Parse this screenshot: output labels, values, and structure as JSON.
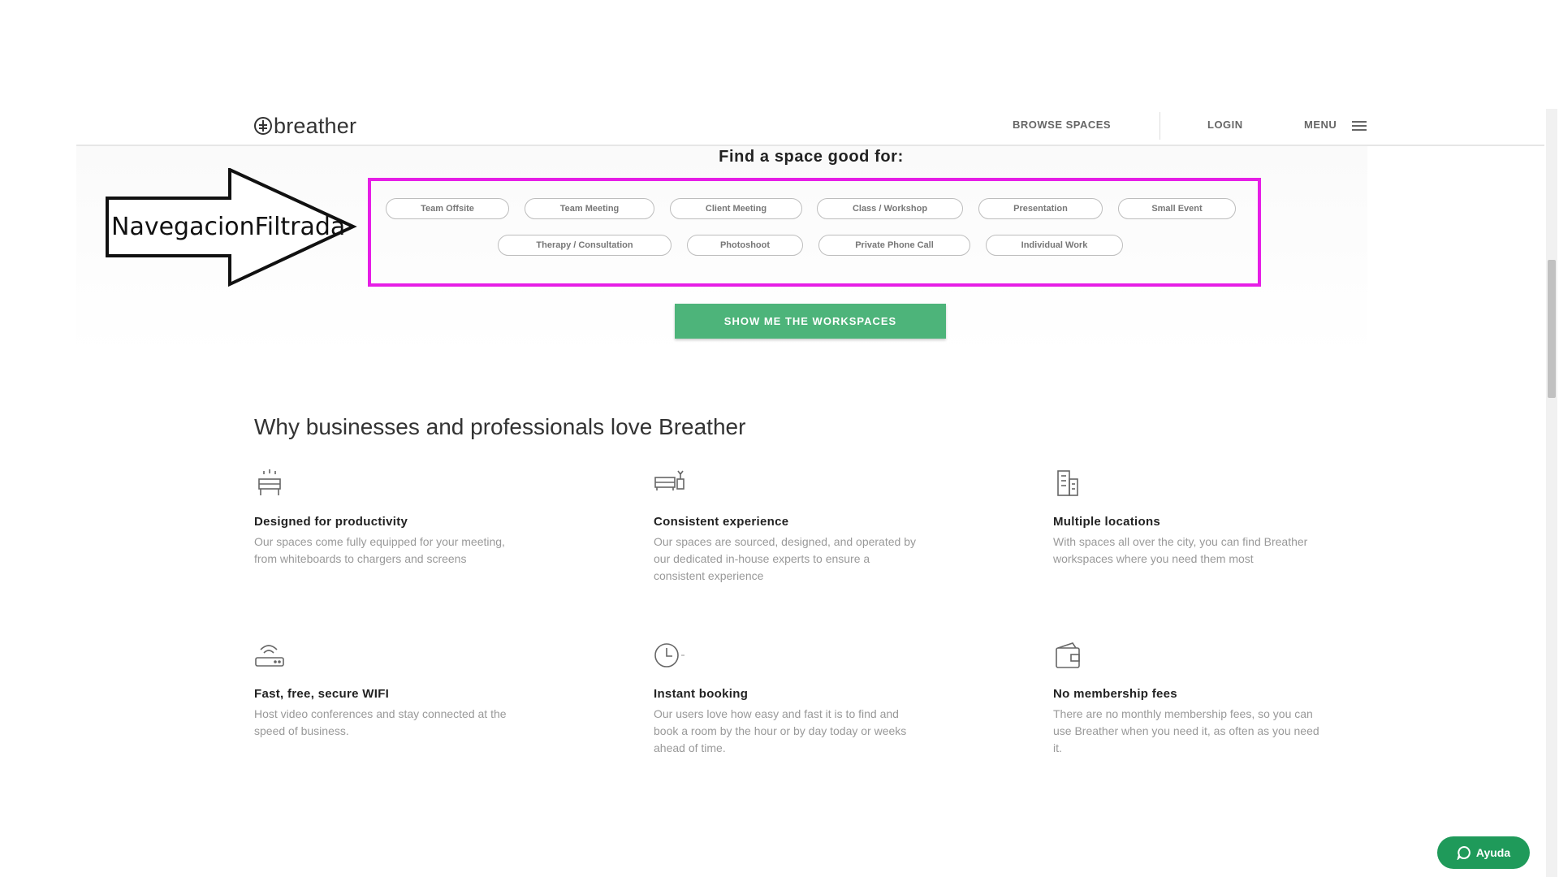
{
  "brand": {
    "name": "breather"
  },
  "nav": {
    "browse": "BROWSE SPACES",
    "login": "LOGIN",
    "menu": "MENU"
  },
  "annotation": {
    "label": "NavegacionFiltrada"
  },
  "filter": {
    "title": "Find a space good for:",
    "chips_row1": [
      "Team Offsite",
      "Team Meeting",
      "Client Meeting",
      "Class / Workshop",
      "Presentation",
      "Small Event"
    ],
    "chips_row2": [
      "Therapy / Consultation",
      "Photoshoot",
      "Private Phone Call",
      "Individual Work"
    ],
    "cta": "SHOW ME THE WORKSPACES"
  },
  "why": {
    "title": "Why businesses and professionals love Breather",
    "features": [
      {
        "icon": "desk-icon",
        "title": "Designed for productivity",
        "desc": "Our spaces come fully equipped for your meeting, from whiteboards to chargers and screens"
      },
      {
        "icon": "sofa-plant-icon",
        "title": "Consistent experience",
        "desc": "Our spaces are sourced, designed, and operated by our dedicated in-house experts to ensure a consistent experience"
      },
      {
        "icon": "buildings-icon",
        "title": "Multiple locations",
        "desc": "With spaces all over the city, you can find Breather workspaces where you need them most"
      },
      {
        "icon": "router-icon",
        "title": "Fast, free, secure WIFI",
        "desc": "Host video conferences and stay connected at the speed of business."
      },
      {
        "icon": "clock-icon",
        "title": "Instant booking",
        "desc": "Our users love how easy and fast it is to find and book a room   by the hour or by day   today or weeks ahead of time."
      },
      {
        "icon": "wallet-icon",
        "title": "No membership fees",
        "desc": "There are no monthly membership fees, so you can use Breather when you need it, as often as you need it."
      }
    ]
  },
  "help": {
    "label": "Ayuda"
  },
  "colors": {
    "accent": "#4db47a",
    "highlight": "#e61ee6",
    "help": "#1f9a5a"
  }
}
